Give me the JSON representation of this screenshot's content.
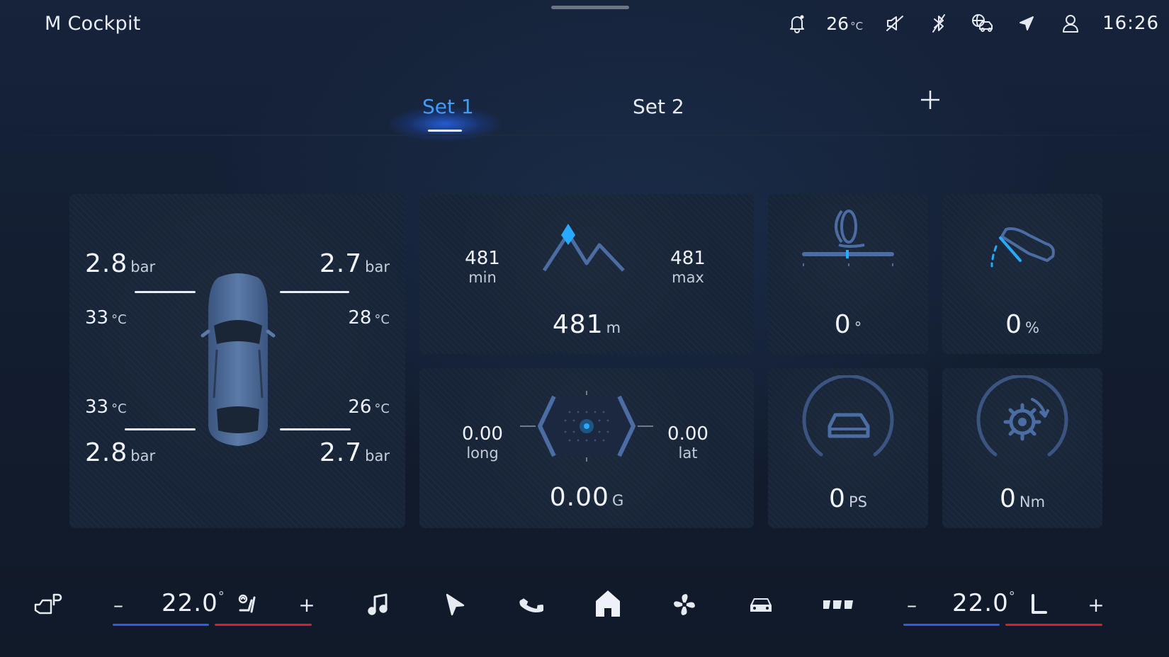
{
  "header": {
    "app_title": "M Cockpit",
    "temperature_value": "26",
    "temperature_unit": "°C",
    "time": "16:26",
    "icons": [
      "bell-icon",
      "mute-icon",
      "bluetooth-off-icon",
      "connected-car-icon",
      "navigation-arrow-icon",
      "profile-icon"
    ]
  },
  "tabs": {
    "items": [
      {
        "label": "Set 1",
        "active": true
      },
      {
        "label": "Set 2",
        "active": false
      }
    ],
    "add_label": "+"
  },
  "tires": {
    "front_left": {
      "pressure": "2.8",
      "unit": "bar",
      "temp": "33",
      "temp_unit": "°C"
    },
    "front_right": {
      "pressure": "2.7",
      "unit": "bar",
      "temp": "28",
      "temp_unit": "°C"
    },
    "rear_left": {
      "pressure": "2.8",
      "unit": "bar",
      "temp": "33",
      "temp_unit": "°C"
    },
    "rear_right": {
      "pressure": "2.7",
      "unit": "bar",
      "temp": "26",
      "temp_unit": "°C"
    }
  },
  "altitude": {
    "min_value": "481",
    "min_label": "min",
    "max_value": "481",
    "max_label": "max",
    "current": "481",
    "unit": "m"
  },
  "steering": {
    "value": "0",
    "unit": "°"
  },
  "throttle": {
    "value": "0",
    "unit": "%"
  },
  "gforce": {
    "long_value": "0.00",
    "long_label": "long",
    "lat_value": "0.00",
    "lat_label": "lat",
    "total": "0.00",
    "unit": "G"
  },
  "power": {
    "value": "0",
    "unit": "PS"
  },
  "torque": {
    "value": "0",
    "unit": "Nm"
  },
  "bottom_bar": {
    "left_temp": "22.0",
    "right_temp": "22.0",
    "degree": "°",
    "minus": "–",
    "plus": "+",
    "icons": [
      "park-assist-icon",
      "seat-heating-icon",
      "music-icon",
      "navigation-icon",
      "phone-icon",
      "home-icon",
      "fan-icon",
      "car-icon",
      "apps-icon",
      "seat-icon"
    ]
  },
  "colors": {
    "accent": "#3d9cff",
    "panel": "#172437",
    "cool": "#2f5de0",
    "warm": "#d81f2c"
  }
}
